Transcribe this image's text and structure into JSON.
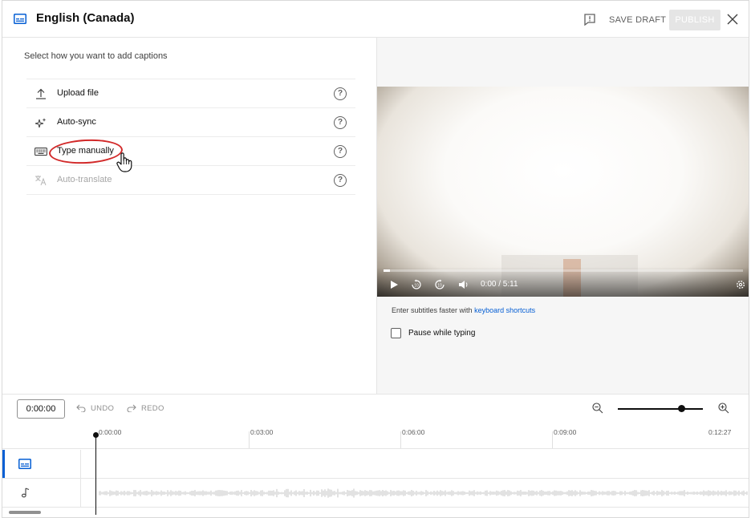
{
  "header": {
    "title": "English (Canada)",
    "title_icon": "subtitles-icon",
    "feedback_icon": "feedback-icon",
    "save_draft": "SAVE DRAFT",
    "publish": "PUBLISH",
    "close_icon": "close-icon"
  },
  "left": {
    "title": "Select how you want to add captions",
    "options": [
      {
        "label": "Upload file",
        "icon": "upload-icon",
        "enabled": true
      },
      {
        "label": "Auto-sync",
        "icon": "sparkle-icon",
        "enabled": true
      },
      {
        "label": "Type manually",
        "icon": "keyboard-icon",
        "enabled": true,
        "highlighted": true
      },
      {
        "label": "Auto-translate",
        "icon": "translate-icon",
        "enabled": false
      }
    ],
    "help_glyph": "?"
  },
  "player": {
    "time": "0:00 / 5:11",
    "progress_fraction": 0.0,
    "hint_prefix": "Enter subtitles faster with",
    "hint_link": "keyboard shortcuts",
    "pause_label": "Pause while typing",
    "pause_checked": false
  },
  "timeline": {
    "current_time": "0:00:00",
    "undo": "UNDO",
    "redo": "REDO",
    "zoom_level_fraction": 0.73,
    "ticks": [
      "0:00:00",
      "0:03:00",
      "0:06:00",
      "0:09:00",
      "0:12:27"
    ],
    "tracks": [
      {
        "name": "captions",
        "icon": "subtitles-icon",
        "selected": true
      },
      {
        "name": "audio",
        "icon": "music-note-icon",
        "selected": false
      }
    ]
  },
  "colors": {
    "accent": "#065fd4",
    "highlight_ring": "#d22a2a",
    "publish_disabled_bg": "#e5e5e5"
  }
}
